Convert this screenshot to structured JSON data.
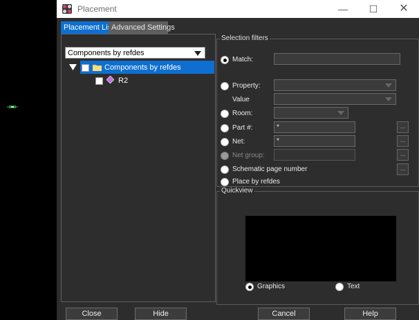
{
  "window": {
    "title": "Placement"
  },
  "tabs": [
    {
      "label": "Placement List",
      "active": true
    },
    {
      "label": "Advanced Settings",
      "active": false
    }
  ],
  "left_panel": {
    "list_type": "Components by refdes",
    "tree": {
      "root": {
        "label": "Components by refdes"
      },
      "children": [
        {
          "label": "R2"
        }
      ]
    }
  },
  "selection_filters": {
    "title": "Selection filters",
    "match": {
      "label": "Match:",
      "value": ""
    },
    "property": {
      "label": "Property:",
      "value_label": "Value"
    },
    "room": {
      "label": "Room:"
    },
    "part": {
      "label": "Part #:",
      "value": "*",
      "browse": "..."
    },
    "net": {
      "label": "Net:",
      "value": "*",
      "browse": "..."
    },
    "net_group": {
      "label": "Net group:",
      "browse": "..."
    },
    "schematic": {
      "label": "Schematic page number",
      "browse": "..."
    },
    "refdes": {
      "label": "Place by refdes"
    }
  },
  "quickview": {
    "title": "Quickview",
    "graphics_label": "Graphics",
    "text_label": "Text"
  },
  "buttons": {
    "close": "Close",
    "hide": "Hide",
    "cancel": "Cancel",
    "help": "Help"
  },
  "colors": {
    "accent": "#0e6fd0",
    "panel_bg": "#2d2d2d"
  }
}
